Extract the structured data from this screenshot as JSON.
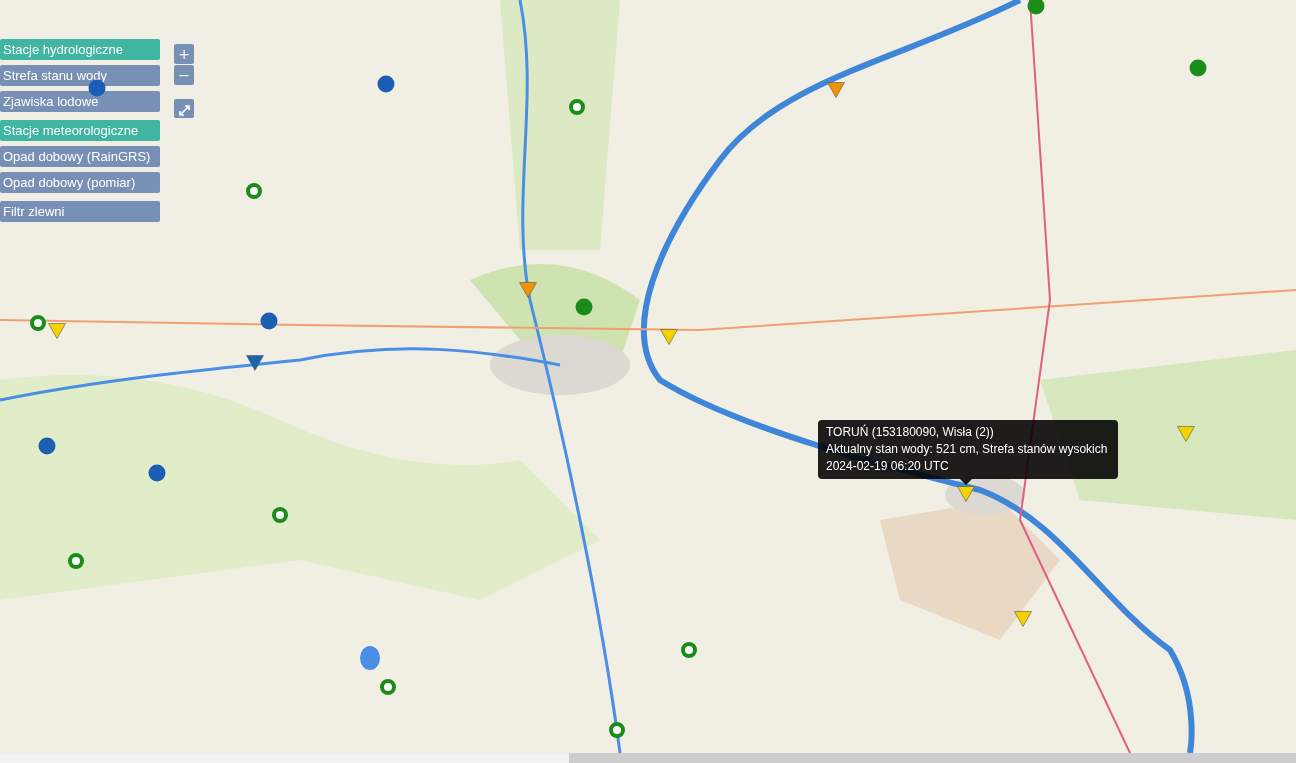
{
  "layer_groups": [
    {
      "buttons": [
        {
          "label": "Stacje hydrologiczne",
          "selected": true
        },
        {
          "label": "Strefa stanu wody",
          "selected": false
        },
        {
          "label": "Zjawiska lodowe",
          "selected": false
        }
      ]
    },
    {
      "buttons": [
        {
          "label": "Stacje meteorologiczne",
          "selected": true
        },
        {
          "label": "Opad dobowy (RainGRS)",
          "selected": false
        },
        {
          "label": "Opad dobowy (pomiar)",
          "selected": false
        }
      ]
    },
    {
      "buttons": [
        {
          "label": "Filtr zlewni",
          "selected": false
        }
      ]
    }
  ],
  "zoom_controls": {
    "zoom_in": "+",
    "zoom_out": "−"
  },
  "markers": [
    {
      "kind": "circle",
      "color": "#1a8c1a"
    },
    {
      "kind": "circle",
      "color": "#1a5fb4"
    },
    {
      "kind": "circle",
      "color": "#1a5fb4"
    },
    {
      "kind": "ring",
      "color": "#1a8c1a"
    },
    {
      "kind": "triangle",
      "color": "#f39200"
    },
    {
      "kind": "circle",
      "color": "#1a8c1a"
    },
    {
      "kind": "ring",
      "color": "#1a8c1a"
    },
    {
      "kind": "triangle",
      "color": "#f39200"
    },
    {
      "kind": "circle",
      "color": "#1a8c1a"
    },
    {
      "kind": "ring",
      "color": "#1a8c1a"
    },
    {
      "kind": "triangle",
      "color": "#f2d300"
    },
    {
      "kind": "circle",
      "color": "#1a5fb4"
    },
    {
      "kind": "triangle",
      "color": "#f2d300"
    },
    {
      "kind": "triangle",
      "color": "#1765b0"
    },
    {
      "kind": "circle",
      "color": "#1a5fb4"
    },
    {
      "kind": "circle",
      "color": "#1a5fb4"
    },
    {
      "kind": "triangle",
      "color": "#f2d300"
    },
    {
      "kind": "triangle",
      "color": "#f2d300"
    },
    {
      "kind": "ring",
      "color": "#1a8c1a"
    },
    {
      "kind": "ring",
      "color": "#1a8c1a"
    },
    {
      "kind": "triangle",
      "color": "#f2d300"
    },
    {
      "kind": "ring",
      "color": "#1a8c1a"
    },
    {
      "kind": "ring",
      "color": "#1a8c1a"
    },
    {
      "kind": "ring",
      "color": "#1a8c1a"
    }
  ],
  "tooltip": {
    "lines": [
      "TORUŃ (153180090, Wisła (2))",
      "Aktualny stan wody: 521 cm, Strefa stanów wysokich",
      "2024-02-19 06:20 UTC"
    ]
  }
}
